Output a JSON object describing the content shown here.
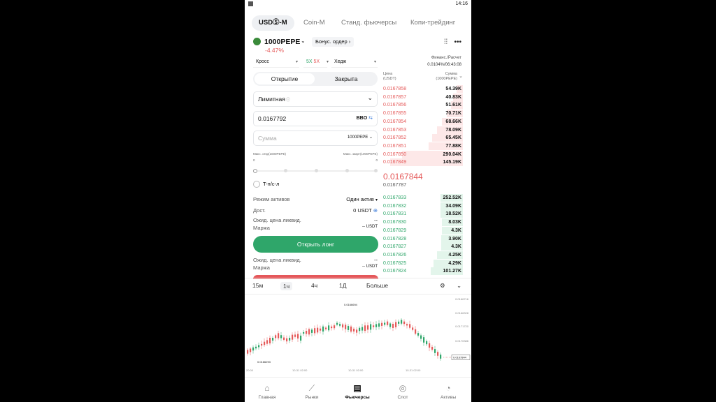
{
  "status": {
    "time": "14:16"
  },
  "tabs": [
    {
      "label": "USDⓈ-M",
      "active": true
    },
    {
      "label": "Coin-M",
      "active": false
    },
    {
      "label": "Станд. фьючерсы",
      "active": false
    },
    {
      "label": "Копи-трейдинг",
      "active": false
    }
  ],
  "pair": {
    "name": "1000PEPE",
    "change": "-4.47%",
    "bonus_label": "Бонус. ордер"
  },
  "funding": {
    "label": "Финанс./Расчет",
    "value": "0.0104%/06:43:08"
  },
  "selects": {
    "margin": "Кросс",
    "leverage": "5X",
    "leverage2": "5X",
    "mode": "Хедж"
  },
  "order_tabs": {
    "open": "Открытие",
    "close": "Закрыта"
  },
  "order": {
    "type": "Лимитная",
    "price": "0.0167792",
    "bbo": "BBO",
    "amount_placeholder": "Сумма",
    "amount_unit": "1000PEPE",
    "max_open_label": "Макс. откр(1000PEPE)",
    "max_open_value": "0",
    "max_close_label": "Макс. закрт(1000PEPE)",
    "max_close_value": "0",
    "tpsl": "T-п/с-л",
    "asset_mode_label": "Режим активов",
    "asset_mode_value": "Один актив",
    "avail_label": "Дост.",
    "avail_value": "0 USDT",
    "liq_label": "Ожид. цена ликвид.",
    "liq_value": "--",
    "margin_label": "Маржа",
    "margin_value": "-- USDT",
    "open_long": "Открыть лонг",
    "liq_label2": "Ожид. цена ликвид.",
    "liq_value2": "--",
    "margin_label2": "Маржа",
    "margin_value2": "-- USDT"
  },
  "orderbook": {
    "price_head": "Цена\n(USDT)",
    "sum_head": "Сумма\n(1000PEPE)",
    "asks": [
      {
        "price": "0.0167858",
        "size": "54.39K",
        "depth": 0.08
      },
      {
        "price": "0.0167857",
        "size": "40.83K",
        "depth": 0.12
      },
      {
        "price": "0.0167856",
        "size": "51.61K",
        "depth": 0.15
      },
      {
        "price": "0.0167855",
        "size": "70.71K",
        "depth": 0.2
      },
      {
        "price": "0.0167854",
        "size": "68.66K",
        "depth": 0.26
      },
      {
        "price": "0.0167853",
        "size": "78.09K",
        "depth": 0.32
      },
      {
        "price": "0.0167852",
        "size": "65.45K",
        "depth": 0.38
      },
      {
        "price": "0.0167851",
        "size": "77.88K",
        "depth": 0.42
      },
      {
        "price": "0.0167850",
        "size": "290.04K",
        "depth": 0.75
      },
      {
        "price": "0.0167849",
        "size": "145.19K",
        "depth": 0.9
      }
    ],
    "last_price": "0.0167844",
    "mark_price": "0.0167787",
    "bids": [
      {
        "price": "0.0167833",
        "size": "252.52K",
        "depth": 0.28
      },
      {
        "price": "0.0167832",
        "size": "34.09K",
        "depth": 0.28
      },
      {
        "price": "0.0167831",
        "size": "18.52K",
        "depth": 0.28
      },
      {
        "price": "0.0167830",
        "size": "8.03K",
        "depth": 0.26
      },
      {
        "price": "0.0167829",
        "size": "4.3K",
        "depth": 0.26
      },
      {
        "price": "0.0167828",
        "size": "3.90K",
        "depth": 0.27
      },
      {
        "price": "0.0167827",
        "size": "4.3K",
        "depth": 0.27
      },
      {
        "price": "0.0167826",
        "size": "4.25K",
        "depth": 0.32
      },
      {
        "price": "0.0167825",
        "size": "4.29K",
        "depth": 0.36
      },
      {
        "price": "0.0167824",
        "size": "101.27K",
        "depth": 0.4
      }
    ]
  },
  "timeframes": {
    "m15": "15м",
    "h1": "1ч",
    "h4": "4ч",
    "d1": "1Д",
    "more": "Больше"
  },
  "chart": {
    "high_label": "0.0166694",
    "low_label": "0.0166293",
    "last_label": "0.0167844",
    "y_ticks": [
      "0.0166716",
      "0.0166328",
      "0.0171720",
      "0.0170386"
    ],
    "x_ticks": [
      "20:00",
      "10-31 02:00",
      "10-31 02:00",
      "10-31 02:00"
    ]
  },
  "chart_data": {
    "type": "candlestick",
    "y_ticks": [
      "0.0166716",
      "0.0166328",
      "0.0171720",
      "0.0170386"
    ],
    "x_ticks": [
      "20:00",
      "10-31 02:00",
      "10-31 02:00",
      "10-31 02:00"
    ],
    "annotations": [
      "0.0166694",
      "0.0166293",
      "0.0167844"
    ]
  },
  "nav": [
    {
      "label": "Главная",
      "icon": "home-icon",
      "active": false
    },
    {
      "label": "Рынки",
      "icon": "markets-icon",
      "active": false
    },
    {
      "label": "Фьючерсы",
      "icon": "futures-icon",
      "active": true
    },
    {
      "label": "Слот",
      "icon": "slot-icon",
      "active": false
    },
    {
      "label": "Активы",
      "icon": "assets-icon",
      "active": false
    }
  ]
}
